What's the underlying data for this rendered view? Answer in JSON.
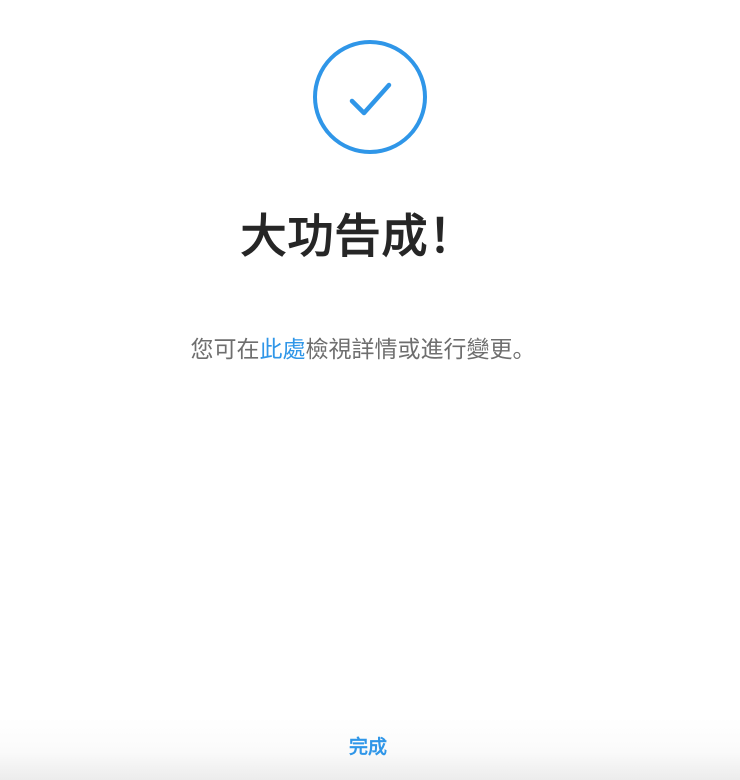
{
  "icon": {
    "name": "check-circle-icon",
    "color": "#2f96e8"
  },
  "title": "大功告成！",
  "message": {
    "before": "您可在",
    "link": "此處",
    "after": "檢視詳情或進行變更。"
  },
  "actions": {
    "done_label": "完成"
  },
  "colors": {
    "accent": "#2f96e8",
    "title": "#262626",
    "body_text": "#6e6e6e"
  }
}
